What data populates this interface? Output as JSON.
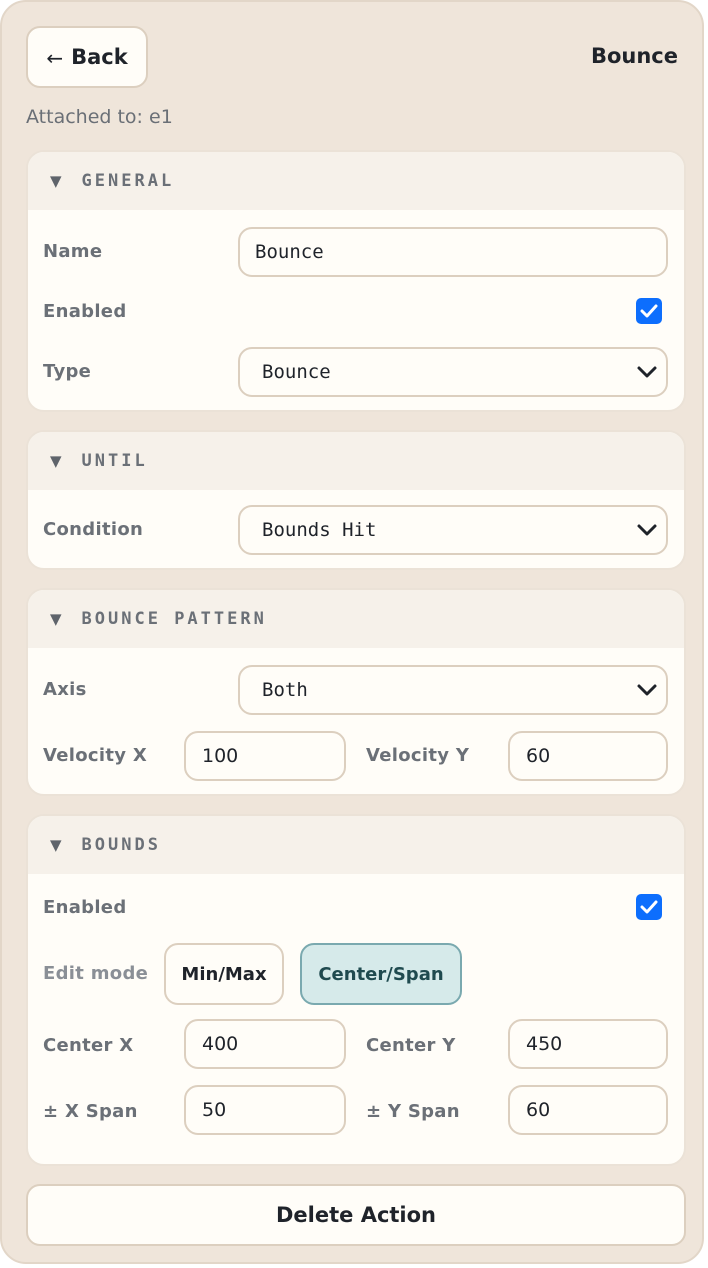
{
  "header": {
    "back_label": "Back",
    "back_arrow": "←",
    "title": "Bounce",
    "attached": "Attached to: e1"
  },
  "sections": {
    "general": {
      "title": "GENERAL",
      "toggle": "▼",
      "name_label": "Name",
      "name_value": "Bounce",
      "enabled_label": "Enabled",
      "enabled": true,
      "type_label": "Type",
      "type_value": "Bounce"
    },
    "until": {
      "title": "UNTIL",
      "toggle": "▼",
      "condition_label": "Condition",
      "condition_value": "Bounds Hit"
    },
    "bounce_pattern": {
      "title": "BOUNCE PATTERN",
      "toggle": "▼",
      "axis_label": "Axis",
      "axis_value": "Both",
      "velocity_x_label": "Velocity X",
      "velocity_x_value": "100",
      "velocity_y_label": "Velocity Y",
      "velocity_y_value": "60"
    },
    "bounds": {
      "title": "BOUNDS",
      "toggle": "▼",
      "enabled_label": "Enabled",
      "enabled": true,
      "edit_mode_label": "Edit mode",
      "mode_minmax": "Min/Max",
      "mode_centerspan": "Center/Span",
      "active_mode": "Center/Span",
      "center_x_label": "Center X",
      "center_x_value": "400",
      "center_y_label": "Center Y",
      "center_y_value": "450",
      "x_span_label": "± X Span",
      "x_span_value": "50",
      "y_span_label": "± Y Span",
      "y_span_value": "60"
    }
  },
  "footer": {
    "delete_label": "Delete Action"
  },
  "icons": {
    "checkbox": "checkbox-checked-icon",
    "select": "chevron-down-icon",
    "collapse": "triangle-down-icon"
  },
  "colors": {
    "panel_bg": "#efe5da",
    "card_bg": "#fffdf8",
    "checkbox": "#0d6efd",
    "active_mode_bg": "#d6eaea"
  }
}
